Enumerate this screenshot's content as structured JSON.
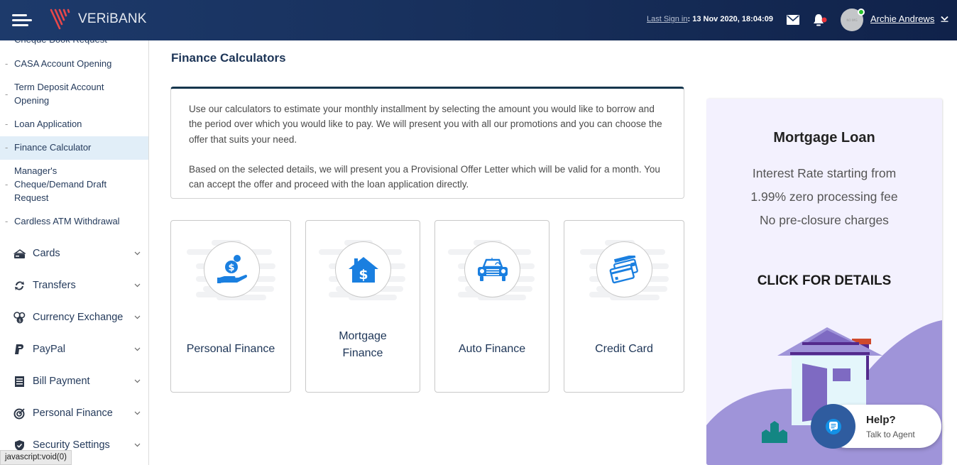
{
  "header": {
    "brand": "VERiBANK",
    "last_sign_in_label": "Last Sign in",
    "last_sign_in_value": ": 13 Nov 2020, 18:04:09",
    "user_name": "Archie Andrews",
    "avatar_text": "NO IMG",
    "notification_dot_color": "#e8333a",
    "online_dot_color": "#25c12a"
  },
  "sidebar": {
    "sub_items": [
      {
        "label": "Cheque Book Request"
      },
      {
        "label": "CASA Account Opening"
      },
      {
        "label": "Term Deposit Account Opening"
      },
      {
        "label": "Loan Application"
      },
      {
        "label": "Finance Calculator",
        "active": true
      },
      {
        "label": "Manager's Cheque/Demand Draft Request"
      },
      {
        "label": "Cardless ATM Withdrawal"
      }
    ],
    "sections": [
      {
        "label": "Cards",
        "icon": "card-icon"
      },
      {
        "label": "Transfers",
        "icon": "transfer-icon"
      },
      {
        "label": "Currency Exchange",
        "icon": "currency-exchange-icon"
      },
      {
        "label": "PayPal",
        "icon": "paypal-icon"
      },
      {
        "label": "Bill Payment",
        "icon": "bill-icon"
      },
      {
        "label": "Personal Finance",
        "icon": "target-icon"
      },
      {
        "label": "Security Settings",
        "icon": "shield-icon"
      }
    ]
  },
  "status_bar_url": "javascript:void(0)",
  "main": {
    "title": "Finance Calculators",
    "intro_p1": "Use our calculators to estimate your monthly installment by selecting the amount you would like to borrow and the period over which you would like to pay. We will present you with all our promotions and you can choose the offer that suits your need.",
    "intro_p2": "Based on the selected details, we will present you a Provisional Offer Letter which will be valid for a month. You can accept the offer and proceed with the loan application directly.",
    "cards": [
      {
        "label": "Personal Finance",
        "icon": "money-hand-icon"
      },
      {
        "label": "Mortgage Finance",
        "icon": "house-dollar-icon"
      },
      {
        "label": "Auto Finance",
        "icon": "car-icon"
      },
      {
        "label": "Credit Card",
        "icon": "credit-cards-icon"
      }
    ],
    "icon_color": "#1a7fe0"
  },
  "promo": {
    "title": "Mortgage Loan",
    "description": "Interest Rate starting from 1.99% zero processing fee No pre-closure charges",
    "cta": "CLICK FOR DETAILS"
  },
  "help_widget": {
    "title": "Help?",
    "subtitle": "Talk to Agent"
  }
}
